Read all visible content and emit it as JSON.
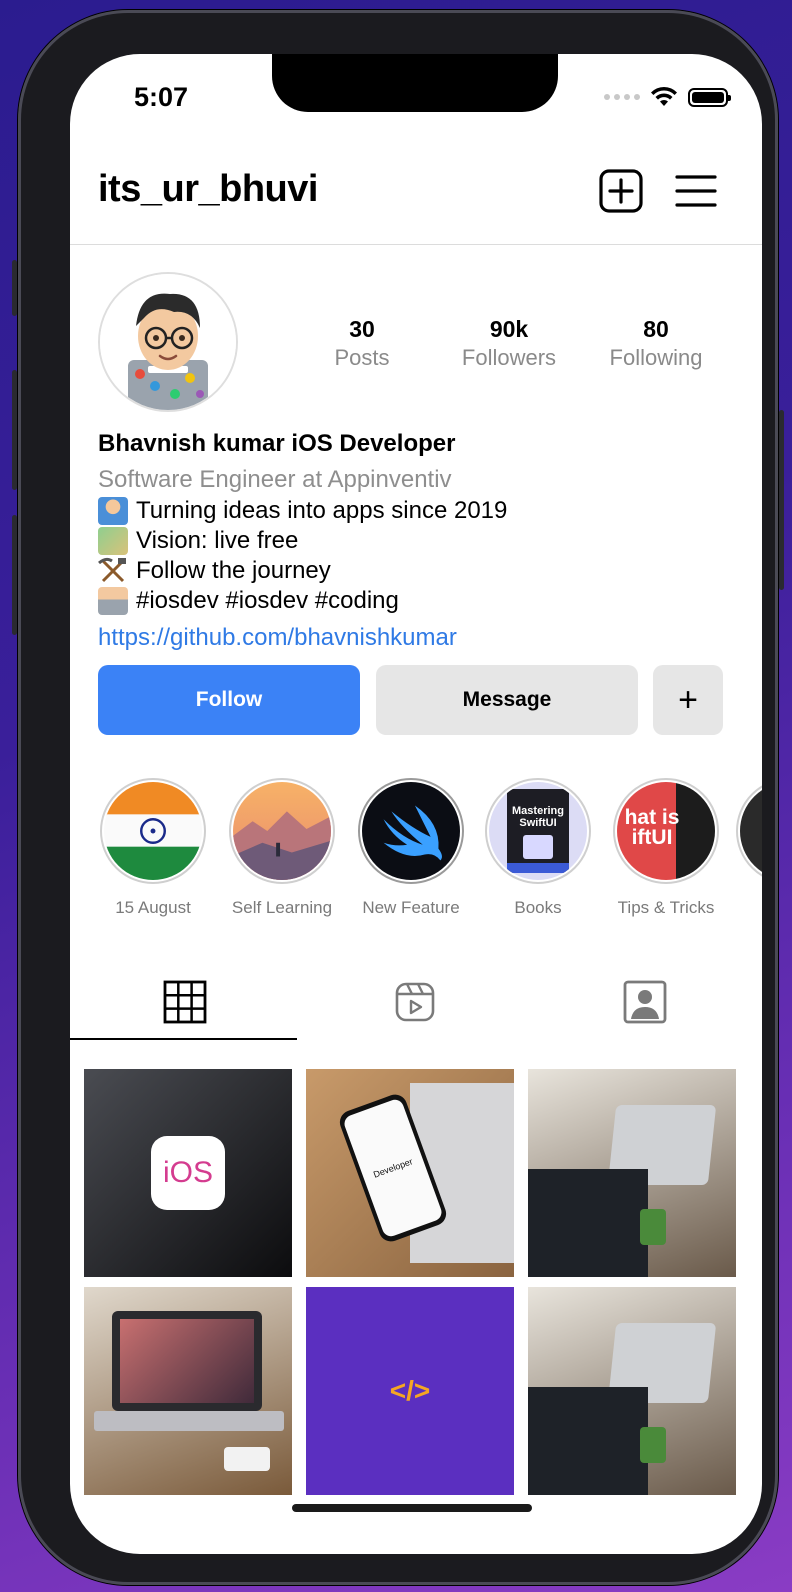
{
  "status_bar": {
    "time": "5:07"
  },
  "header": {
    "username": "its_ur_bhuvi",
    "new_post_icon": "plus-square-icon",
    "menu_icon": "hamburger-menu-icon"
  },
  "profile": {
    "stats": [
      {
        "count": "30",
        "label": "Posts"
      },
      {
        "count": "90k",
        "label": "Followers"
      },
      {
        "count": "80",
        "label": "Following"
      }
    ],
    "name": "Bhavnish kumar iOS Developer",
    "subtitle": "Software Engineer at Appinventiv",
    "bio_lines": [
      {
        "icon": "person-raising-hand-emoji",
        "text": "Turning ideas into apps since 2019"
      },
      {
        "icon": "money-with-wings-emoji",
        "text": "Vision: live free"
      },
      {
        "icon": "hammer-and-pick-emoji",
        "text": "Follow the journey"
      },
      {
        "icon": "technologist-emoji",
        "text": "#iosdev #iosdev #coding"
      }
    ],
    "link": "https://github.com/bhavnishkumar"
  },
  "actions": {
    "follow": "Follow",
    "message": "Message",
    "more": "+"
  },
  "highlights": [
    {
      "label": "15 August"
    },
    {
      "label": "Self Learning"
    },
    {
      "label": "New Feature"
    },
    {
      "label": "Books"
    },
    {
      "label": "Tips & Tricks"
    }
  ],
  "tabs": [
    {
      "icon": "grid-icon",
      "active": true
    },
    {
      "icon": "reels-icon",
      "active": false
    },
    {
      "icon": "tagged-person-icon",
      "active": false
    }
  ],
  "posts": [
    {
      "name": "ios-logo-post",
      "badge": "iOS"
    },
    {
      "name": "iphone-on-laptop-post",
      "badge": "Developer"
    },
    {
      "name": "developers-coding-post"
    },
    {
      "name": "laptop-typing-post"
    },
    {
      "name": "code-symbol-post",
      "badge": "</>"
    },
    {
      "name": "developers-coding-post-2"
    }
  ],
  "highlight_text": {
    "books_title": "Mastering SwiftUI",
    "tips_text": "hat is iftUI"
  }
}
